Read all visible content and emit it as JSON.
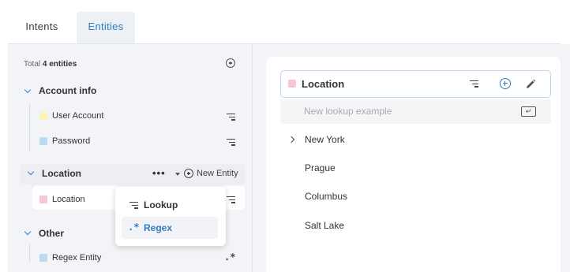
{
  "tabs": [
    {
      "label": "Intents",
      "active": false
    },
    {
      "label": "Entities",
      "active": true
    }
  ],
  "sidebar": {
    "total_prefix": "Total",
    "total_count": "4 entities",
    "groups": [
      {
        "title": "Account info",
        "items": [
          {
            "label": "User Account",
            "color": "#fdf3b7",
            "icon": "lookup-lines-icon"
          },
          {
            "label": "Password",
            "color": "#b9dcf3",
            "icon": "lookup-lines-icon"
          }
        ]
      },
      {
        "title": "Location",
        "items": [
          {
            "label": "Location",
            "color": "#f7c6d6",
            "icon": "lookup-lines-icon"
          }
        ]
      },
      {
        "title": "Other",
        "items": [
          {
            "label": "Regex Entity",
            "color": "#b9dcf3",
            "icon": "regex-icon"
          }
        ]
      }
    ],
    "group_actions": {
      "more": "•••",
      "new_entity": "New Entity"
    }
  },
  "dropdown": {
    "items": [
      {
        "label": "Lookup",
        "icon": "lookup-lines-icon",
        "active": false
      },
      {
        "label": "Regex",
        "icon": "regex-icon",
        "active": true
      }
    ]
  },
  "detail": {
    "entity_name": "Location",
    "entity_color": "#f7c6d6",
    "new_lookup_placeholder": "New lookup example",
    "enter_key": "↵",
    "values": [
      "New York",
      "Prague",
      "Columbus",
      "Salt Lake"
    ]
  },
  "colors": {
    "accent": "#2e7dbf",
    "panel_bg": "#f3f4f7",
    "header_border": "#b8d6ef"
  }
}
